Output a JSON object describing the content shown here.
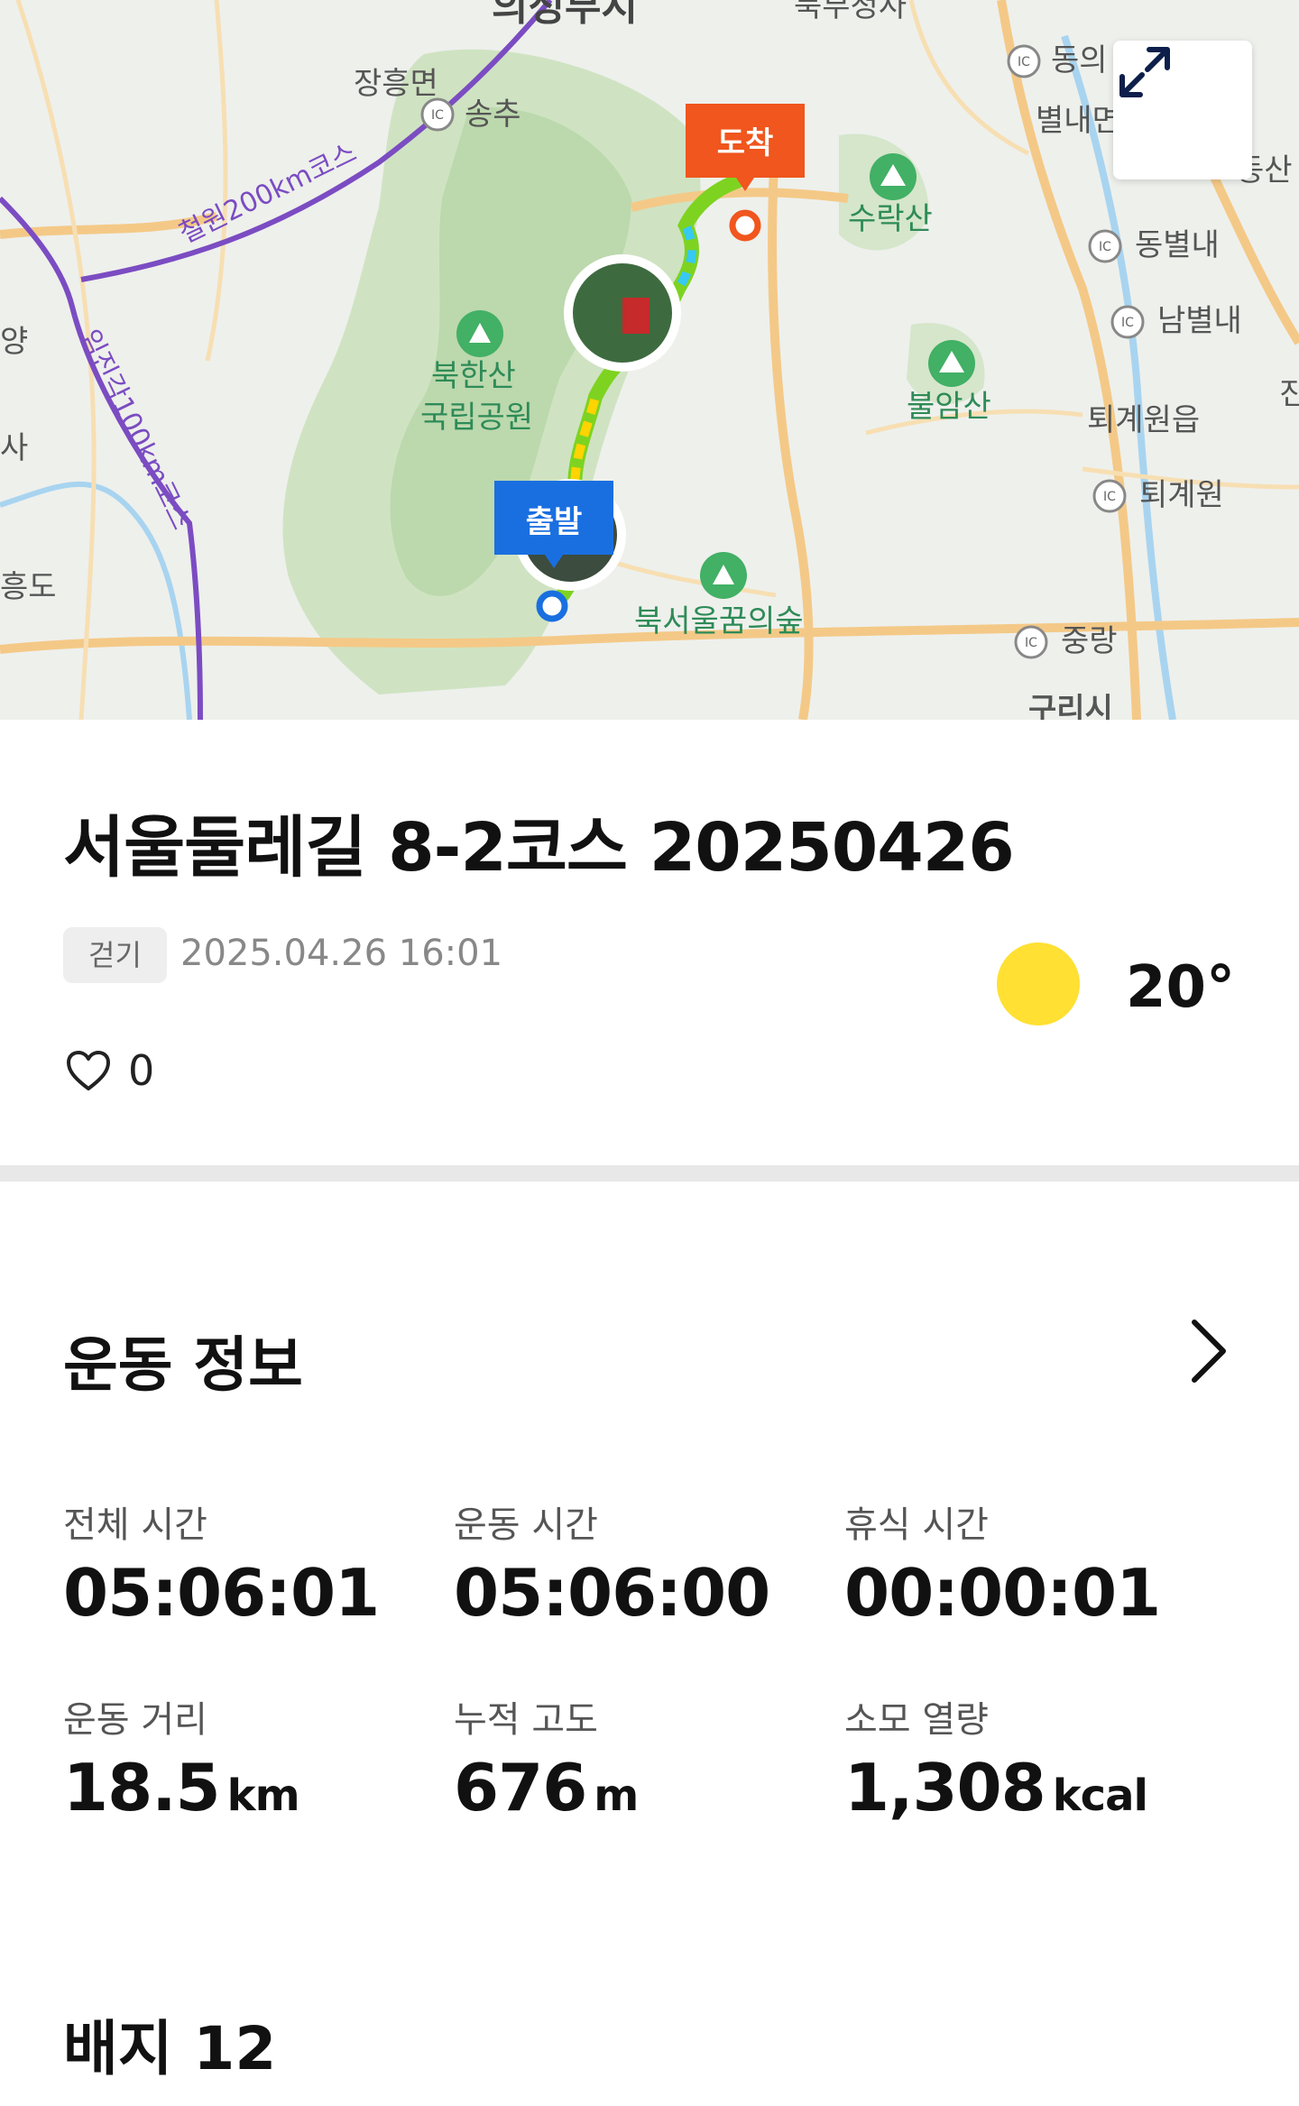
{
  "map": {
    "labels": {
      "uijeongbu": "의정부시",
      "janghung": "장흥면",
      "songchu": "송추",
      "bukbu": "북부청사",
      "dongui": "동의",
      "byeolnae": "별내면",
      "dongsan": "동산",
      "suraksan": "수락산",
      "dongbyeolnae": "동별내",
      "nambyeolnae": "남별내",
      "bulamsan": "불암산",
      "toegyewon_eup": "퇴계원읍",
      "toegyewon": "퇴계원",
      "bukhansan_1": "북한산",
      "bukhansan_2": "국립공원",
      "bukseoul": "북서울꿈의숲",
      "jungrang": "중랑",
      "cheorwon": "철원200km코스",
      "imjingak": "임진각100km코스",
      "yang": "양",
      "sa": "사",
      "heungdo": "흥도",
      "jin": "진",
      "guri": "구리시",
      "ic": "IC"
    },
    "start_label": "출발",
    "end_label": "도착",
    "route_color": "#7ed321",
    "start_color": "#1a6fe0",
    "end_color": "#f0561d",
    "expand_icon": "expand-icon"
  },
  "activity": {
    "title": "서울둘레길 8-2코스 20250426",
    "type": "걷기",
    "datetime": "2025.04.26 16:01",
    "temperature": "20°",
    "weather_icon": "sun-icon",
    "likes": "0"
  },
  "exercise": {
    "section_title": "운동 정보",
    "stats": [
      {
        "label": "전체 시간",
        "value": "05:06:01",
        "unit": ""
      },
      {
        "label": "운동 시간",
        "value": "05:06:00",
        "unit": ""
      },
      {
        "label": "휴식 시간",
        "value": "00:00:01",
        "unit": ""
      },
      {
        "label": "운동 거리",
        "value": "18.5",
        "unit": "km"
      },
      {
        "label": "누적 고도",
        "value": "676",
        "unit": "m"
      },
      {
        "label": "소모 열량",
        "value": "1,308",
        "unit": "kcal"
      }
    ]
  },
  "badges": {
    "title": "배지 12"
  }
}
